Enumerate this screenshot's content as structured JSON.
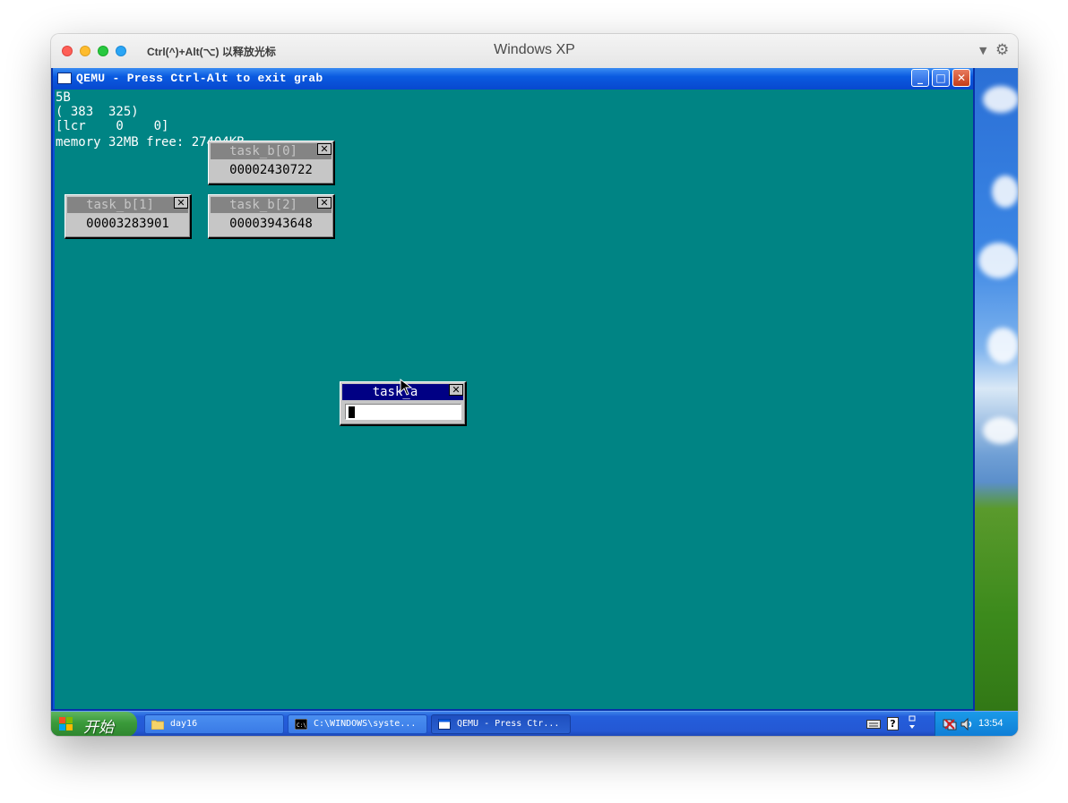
{
  "host": {
    "hint": "Ctrl(^)+Alt(⌥) 以释放光标",
    "title": "Windows XP"
  },
  "qemu": {
    "title": "QEMU - Press Ctrl-Alt to exit grab"
  },
  "guest_os": {
    "lines": [
      "5B",
      "( 383  325)",
      "[lcr    0    0]",
      "memory 32MB free: 27404KB"
    ],
    "background_color": "#008484",
    "windows": [
      {
        "title": "task_b[0]",
        "value": "00002430722"
      },
      {
        "title": "task_b[1]",
        "value": "00003283901"
      },
      {
        "title": "task_b[2]",
        "value": "00003943648"
      },
      {
        "title": "task_a",
        "value": ""
      }
    ],
    "close_glyph": "✕"
  },
  "taskbar": {
    "start_label": "开始",
    "items": [
      {
        "label": "day16",
        "icon": "folder-icon"
      },
      {
        "label": "C:\\WINDOWS\\syste...",
        "icon": "console-icon"
      },
      {
        "label": "QEMU - Press Ctr...",
        "icon": "window-icon"
      }
    ],
    "clock": "13:54"
  },
  "colors": {
    "xp_blue": "#245edb",
    "haribote_gray": "#c6c6c6",
    "active_title": "#000084"
  }
}
